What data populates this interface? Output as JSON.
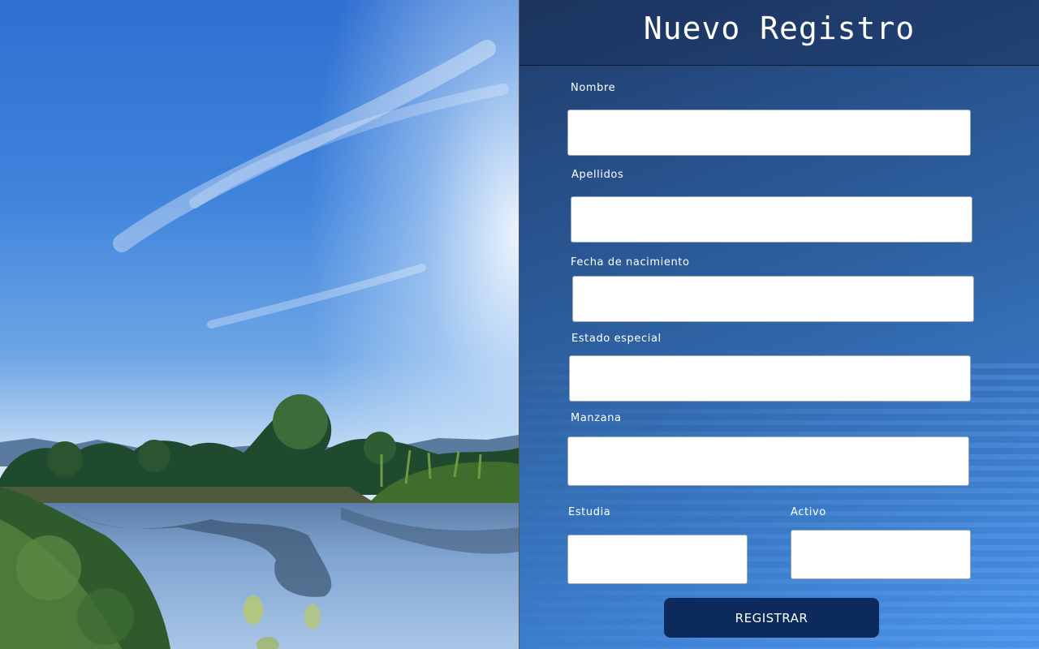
{
  "form": {
    "title": "Nuevo Registro",
    "fields": {
      "nombre": {
        "label": "Nombre",
        "value": ""
      },
      "apellidos": {
        "label": "Apellidos",
        "value": ""
      },
      "fecha_nacimiento": {
        "label": "Fecha de nacimiento",
        "value": ""
      },
      "estado_especial": {
        "label": "Estado especial",
        "value": ""
      },
      "manzana": {
        "label": "Manzana",
        "value": ""
      },
      "estudia": {
        "label": "Estudia",
        "value": ""
      },
      "activo": {
        "label": "Activo",
        "value": ""
      }
    },
    "submit_label": "REGISTRAR"
  },
  "background": {
    "photo": "lake-landscape-image"
  },
  "colors": {
    "button": "#0d2a5c",
    "panel_top": "#1f3b68",
    "panel_bottom": "#4a93ea"
  }
}
